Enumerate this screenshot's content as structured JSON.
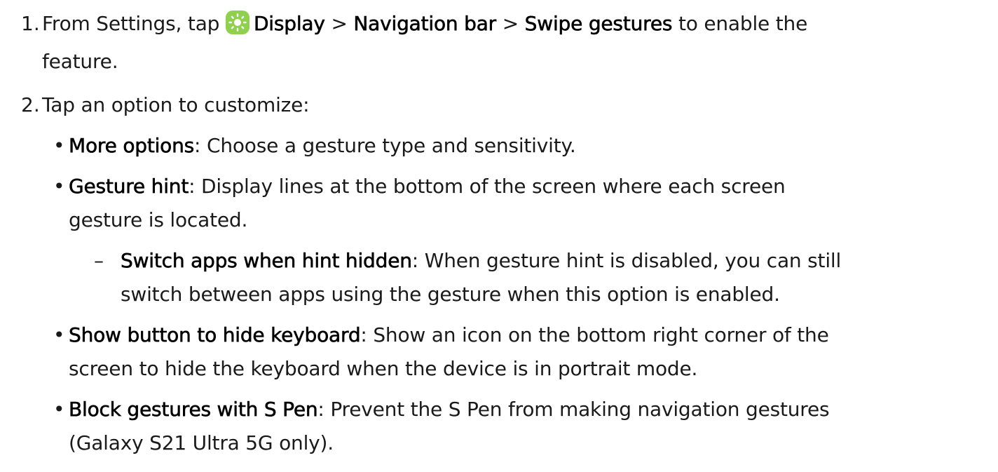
{
  "steps": {
    "s1": {
      "num": "1.",
      "from": "From Settings, tap",
      "display": "Display",
      "sep1": " > ",
      "navigation_bar": "Navigation bar",
      "sep2": " > ",
      "swipe_gestures": "Swipe gestures",
      "tail": " to enable the",
      "cont": "feature."
    },
    "s2": {
      "num": "2.",
      "text": "Tap an option to customize:"
    }
  },
  "options": {
    "more": {
      "title": "More options",
      "desc": ": Choose a gesture type and sensitivity."
    },
    "hint": {
      "title": "Gesture hint",
      "desc": ": Display lines at the bottom of the screen where each screen",
      "cont": "gesture is located."
    },
    "switch": {
      "title": "Switch apps when hint hidden",
      "desc": ": When gesture hint is disabled, you can still",
      "cont": "switch between apps using the gesture when this option is enabled."
    },
    "keyboard": {
      "title": "Show button to hide keyboard",
      "desc": ": Show an icon on the bottom right corner of the",
      "cont": "screen to hide the keyboard when the device is in portrait mode."
    },
    "spen": {
      "title": "Block gestures with S Pen",
      "desc": ": Prevent the S Pen from making navigation gestures",
      "cont": "(Galaxy S21 Ultra 5G only)."
    }
  },
  "markers": {
    "bullet": "•",
    "dash": "–"
  },
  "icon": {
    "name": "display-settings-icon",
    "color": "#8fd14f"
  }
}
